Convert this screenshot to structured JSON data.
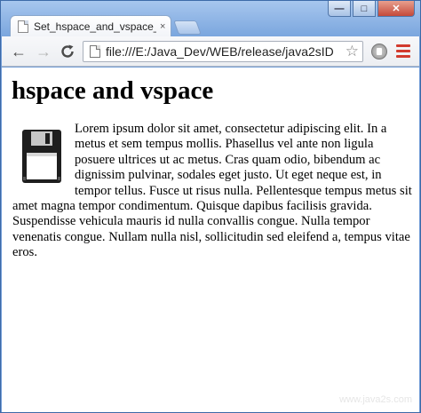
{
  "window": {
    "tab_title": "Set_hspace_and_vspace_A",
    "tab_title_fade": "...",
    "tab_close": "×",
    "controls": {
      "minimize": "—",
      "maximize": "□",
      "close": "✕"
    }
  },
  "toolbar": {
    "back": "←",
    "forward": "→",
    "reload": "C",
    "url": "file:///E:/Java_Dev/WEB/release/java2sID",
    "star": "☆",
    "accent_color": "#d23b2e"
  },
  "page": {
    "heading": "hspace and vspace",
    "image_icon": "floppy-disk-icon",
    "paragraph": "Lorem ipsum dolor sit amet, consectetur adipiscing elit. In a metus et sem tempus mollis. Phasellus vel ante non ligula posuere ultrices ut ac metus. Cras quam odio, bibendum ac dignissim pulvinar, sodales eget justo. Ut eget neque est, in tempor tellus. Fusce ut risus nulla. Pellentesque tempus metus sit amet magna tempor condimentum. Quisque dapibus facilisis gravida. Suspendisse vehicula mauris id nulla convallis congue. Nulla tempor venenatis congue. Nullam nulla nisl, sollicitudin sed eleifend a, tempus vitae eros.",
    "watermark": "www.java2s.com"
  }
}
